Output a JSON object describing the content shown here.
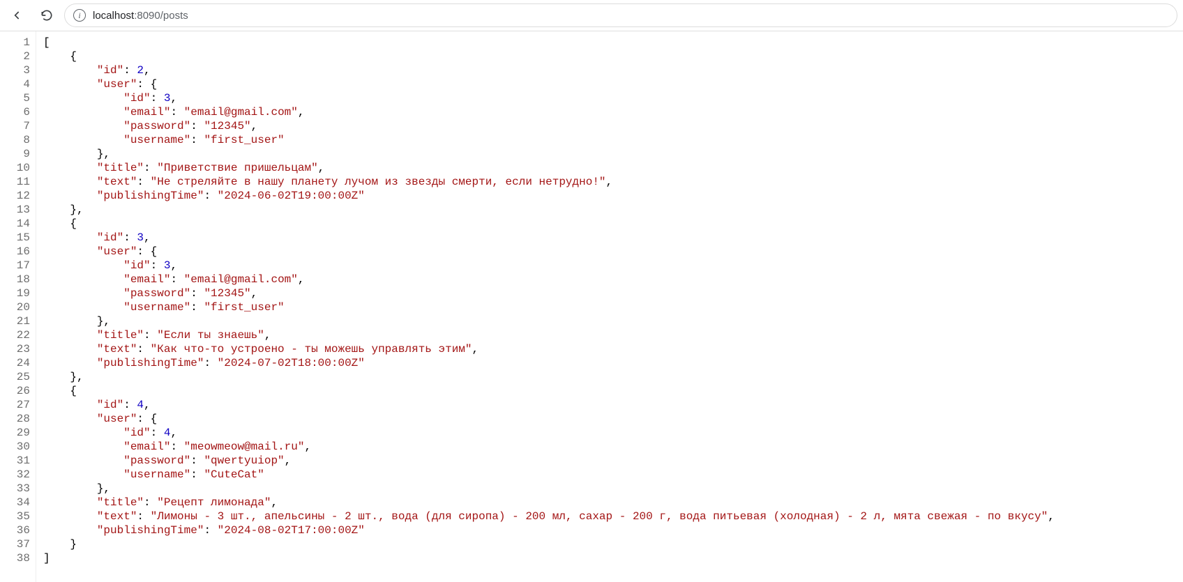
{
  "toolbar": {
    "back_label": "Back",
    "reload_label": "Reload"
  },
  "address": {
    "host": "localhost",
    "port": ":8090",
    "path": "/posts"
  },
  "json_body": [
    {
      "id": 2,
      "user": {
        "id": 3,
        "email": "email@gmail.com",
        "password": "12345",
        "username": "first_user"
      },
      "title": "Приветствие пришельцам",
      "text": "Не стреляйте в нашу планету лучом из звезды смерти, если нетрудно!",
      "publishingTime": "2024-06-02T19:00:00Z"
    },
    {
      "id": 3,
      "user": {
        "id": 3,
        "email": "email@gmail.com",
        "password": "12345",
        "username": "first_user"
      },
      "title": "Если ты знаешь",
      "text": "Как что-то устроено - ты можешь управлять этим",
      "publishingTime": "2024-07-02T18:00:00Z"
    },
    {
      "id": 4,
      "user": {
        "id": 4,
        "email": "meowmeow@mail.ru",
        "password": "qwertyuiop",
        "username": "CuteCat"
      },
      "title": "Рецепт лимонада",
      "text": "Лимоны - 3 шт., апельсины - 2 шт., вода (для сиропа) - 200 мл, сахар - 200 г, вода питьевая (холодная) - 2 л, мята свежая - по вкусу",
      "publishingTime": "2024-08-02T17:00:00Z"
    }
  ]
}
